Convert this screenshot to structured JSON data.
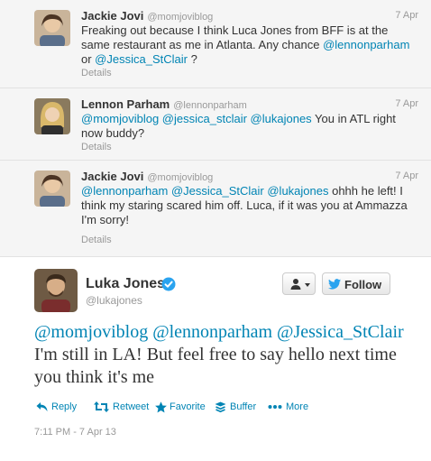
{
  "colors": {
    "link": "#0084b4",
    "meta": "#999999",
    "text": "#333333",
    "reply_bg": "#f5f5f5"
  },
  "replies": [
    {
      "name": "Jackie Jovi",
      "handle": "@momjoviblog",
      "time": "7 Apr",
      "text_parts": [
        {
          "text": "Freaking out because I think Luca Jones from BFF is at the same restaurant as me in Atlanta. Any chance ",
          "mention": false
        },
        {
          "text": "@lennonparham",
          "mention": true
        },
        {
          "text": " or ",
          "mention": false
        },
        {
          "text": "@Jessica_StClair",
          "mention": true
        },
        {
          "text": " ?",
          "mention": false
        }
      ],
      "details": "Details"
    },
    {
      "name": "Lennon Parham",
      "handle": "@lennonparham",
      "time": "7 Apr",
      "text_parts": [
        {
          "text": "@momjoviblog",
          "mention": true
        },
        {
          "text": " ",
          "mention": false
        },
        {
          "text": "@jessica_stclair",
          "mention": true
        },
        {
          "text": " ",
          "mention": false
        },
        {
          "text": "@lukajones",
          "mention": true
        },
        {
          "text": " You in ATL right now buddy?",
          "mention": false
        }
      ],
      "details": "Details"
    },
    {
      "name": "Jackie Jovi",
      "handle": "@momjoviblog",
      "time": "7 Apr",
      "text_parts": [
        {
          "text": "@lennonparham",
          "mention": true
        },
        {
          "text": " ",
          "mention": false
        },
        {
          "text": "@Jessica_StClair",
          "mention": true
        },
        {
          "text": " ",
          "mention": false
        },
        {
          "text": "@lukajones",
          "mention": true
        },
        {
          "text": " ohhh he left! I think my staring scared him off. Luca, if it was you at Ammazza I'm sorry!",
          "mention": false
        }
      ],
      "details": "Details"
    }
  ],
  "main_tweet": {
    "name": "Luka Jones",
    "handle": "@lukajones",
    "verified": true,
    "follow_label": "Follow",
    "text_parts": [
      {
        "text": "@momjoviblog",
        "mention": true
      },
      {
        "text": " ",
        "mention": false
      },
      {
        "text": "@lennonparham",
        "mention": true
      },
      {
        "text": " ",
        "mention": false
      },
      {
        "text": "@Jessica_StClair",
        "mention": true
      },
      {
        "text": " I'm still in LA! But feel free to say hello next time you think it's me",
        "mention": false
      }
    ],
    "actions": [
      {
        "label": "Reply",
        "icon": "reply-icon"
      },
      {
        "label": "Retweet",
        "icon": "retweet-icon"
      },
      {
        "label": "Favorite",
        "icon": "star-icon"
      },
      {
        "label": "Buffer",
        "icon": "buffer-icon"
      },
      {
        "label": "More",
        "icon": "more-icon"
      }
    ],
    "timestamp": "7:11 PM - 7 Apr 13"
  }
}
